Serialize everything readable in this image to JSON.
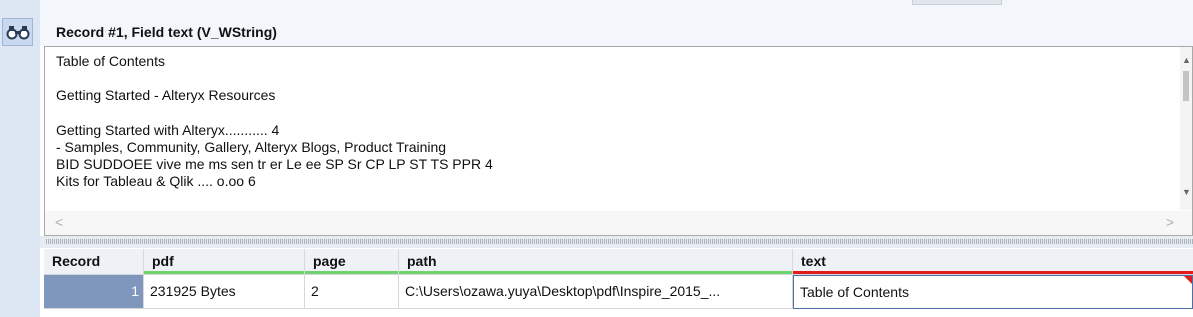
{
  "record_header": {
    "title": "Record #1, Field text (V_WString)"
  },
  "viewer": {
    "text": "Table of Contents\n\nGetting Started - Alteryx Resources\n\nGetting Started with Alteryx........... 4\n- Samples, Community, Gallery, Alteryx Blogs, Product Training\nBID SUDDOEE vive me ms sen tr er Le ee SP Sr CP LP ST TS PPR 4\nKits for Tableau & Qlik .... o.oo 6",
    "scroll_left_glyph": "<",
    "scroll_right_glyph": ">"
  },
  "grid": {
    "columns": [
      "Record",
      "pdf",
      "page",
      "path",
      "text"
    ],
    "column_underline_colors": {
      "pdf": "#6fd36f",
      "page": "#6fd36f",
      "path": "#6fd36f",
      "text": "#e21b1b"
    },
    "rows": [
      {
        "record": "1",
        "pdf": "231925 Bytes",
        "page": "2",
        "path": "C:\\Users\\ozawa.yuya\\Desktop\\pdf\\Inspire_2015_...",
        "text": "Table of Contents"
      }
    ]
  },
  "icons": {
    "left_toolbar": "binoculars-icon"
  },
  "colors": {
    "record_cell_bg": "#7f97bd",
    "gutter_bg": "#dde7f3"
  }
}
